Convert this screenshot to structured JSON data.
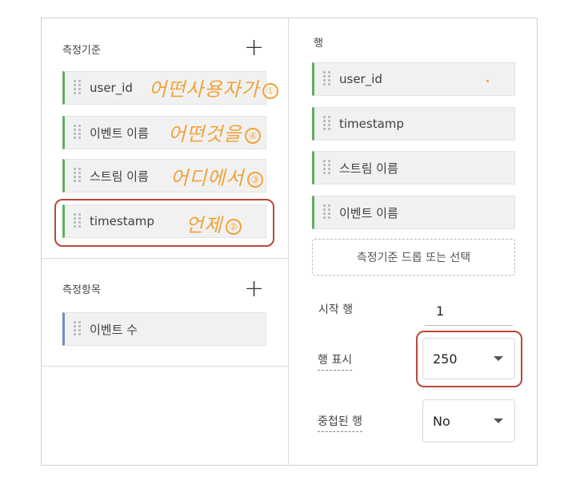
{
  "left": {
    "dimensions": {
      "title": "측정기준",
      "items": [
        "user_id",
        "이벤트 이름",
        "스트림 이름",
        "timestamp"
      ]
    },
    "metrics": {
      "title": "측정항목",
      "items": [
        "이벤트 수"
      ]
    }
  },
  "right": {
    "rows": {
      "title": "행",
      "items": [
        "user_id",
        "timestamp",
        "스트림 이름",
        "이벤트 이름"
      ],
      "drop_zone": "측정기준 드롭 또는 선택"
    },
    "start_row": {
      "label": "시작 행",
      "value": "1"
    },
    "show_rows": {
      "label": "행 표시",
      "value": "250"
    },
    "nested_rows": {
      "label": "중첩된 행",
      "value": "No"
    }
  },
  "annotations": {
    "user_id": "어떤사용자가",
    "event_name": "어떤것을",
    "stream_name": "어디에서",
    "timestamp": "언제",
    "markers": [
      "①",
      "②",
      "③",
      "④"
    ]
  },
  "colors": {
    "dimension_accent": "#62ad62",
    "metric_accent": "#6f8fc4",
    "highlight": "#b9473a",
    "annotation": "#f0a33a"
  }
}
